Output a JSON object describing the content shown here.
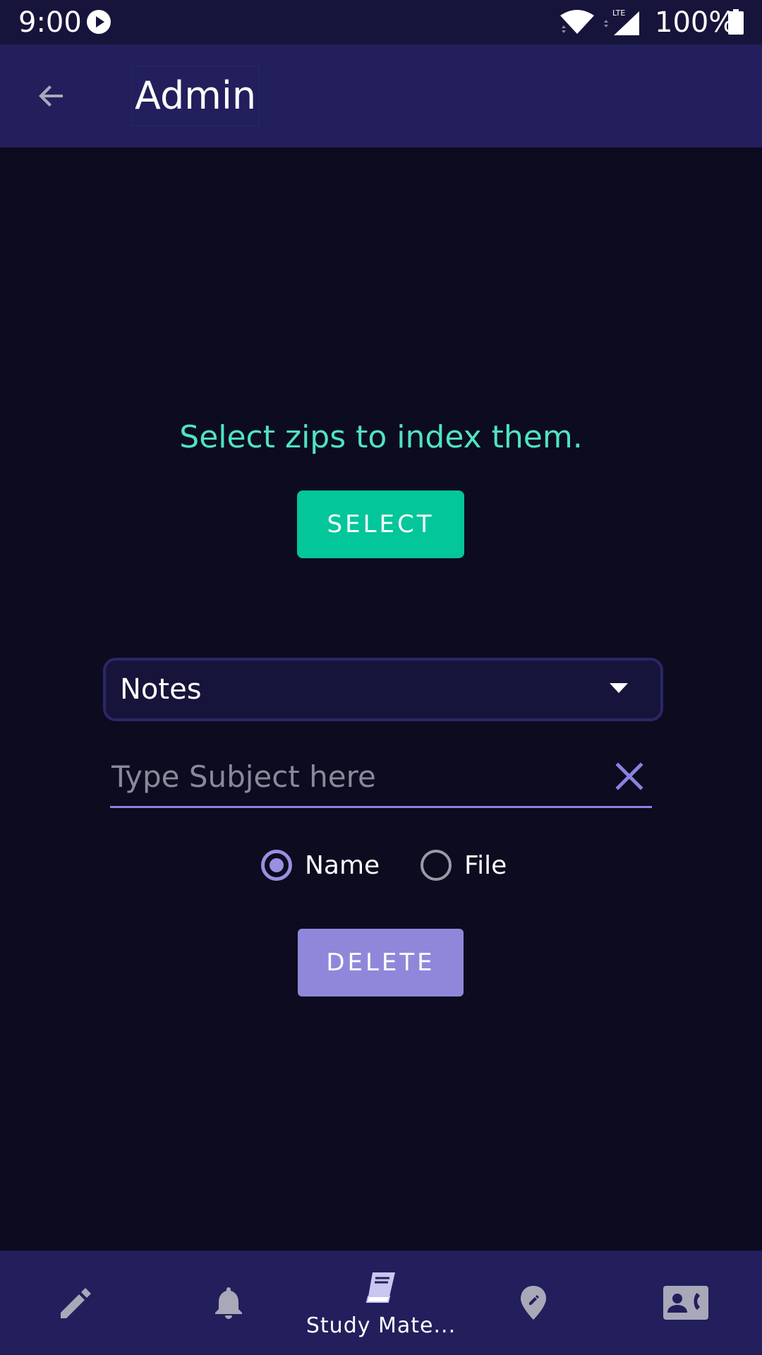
{
  "status_bar": {
    "time": "9:00",
    "battery_text": "100%",
    "icons": [
      "play-icon",
      "wifi-icon",
      "lte-signal-icon",
      "battery-icon"
    ]
  },
  "app_bar": {
    "title": "Admin",
    "back_icon": "arrow-back-icon"
  },
  "main": {
    "prompt": "Select zips to index them.",
    "select_label": "SELECT",
    "dropdown": {
      "selected": "Notes",
      "icon": "dropdown-arrow-icon"
    },
    "subject_field": {
      "value": "",
      "placeholder": "Type Subject here",
      "clear_icon": "close-icon"
    },
    "radio_options": [
      {
        "label": "Name",
        "checked": true
      },
      {
        "label": "File",
        "checked": false
      }
    ],
    "delete_label": "DELETE"
  },
  "bottom_nav": {
    "items": [
      {
        "icon": "pencil-icon",
        "label": ""
      },
      {
        "icon": "bell-icon",
        "label": ""
      },
      {
        "icon": "book-icon",
        "label": "Study Mate...",
        "active": true
      },
      {
        "icon": "location-edit-icon",
        "label": ""
      },
      {
        "icon": "contact-phone-icon",
        "label": ""
      }
    ]
  },
  "colors": {
    "background": "#0c0b1f",
    "status_bar": "#16143a",
    "app_bar": "#221f5c",
    "accent_teal": "#03c69b",
    "prompt_text": "#4fe3c1",
    "accent_purple": "#8f88da",
    "icon_inactive": "#a9a8b8"
  }
}
